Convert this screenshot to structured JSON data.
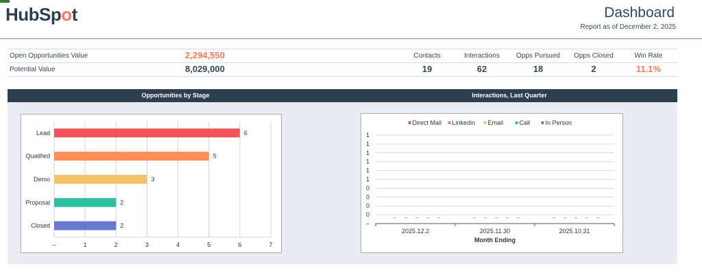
{
  "header": {
    "logo_text_a": "HubSp",
    "logo_text_b": "t",
    "title": "Dashboard",
    "report_date": "Report as of December 2, 2025"
  },
  "kpis": {
    "open_label": "Open Opportunities Value",
    "open_value": "2,294,550",
    "potential_label": "Potential Value",
    "potential_value": "8,029,000",
    "metrics": [
      {
        "label": "Contacts",
        "value": "19"
      },
      {
        "label": "Interactions",
        "value": "62"
      },
      {
        "label": "Opps Pursued",
        "value": "18"
      },
      {
        "label": "Opps Closed",
        "value": "2"
      },
      {
        "label": "Win Rate",
        "value": "11.1%"
      }
    ]
  },
  "panels": {
    "left_title": "Opportunities by Stage",
    "right_title": "Interactions, Last Quarter"
  },
  "chart_data": [
    {
      "type": "bar",
      "orientation": "horizontal",
      "title": "Opportunities by Stage",
      "categories": [
        "Lead",
        "Qualified",
        "Demo",
        "Proposal",
        "Closed"
      ],
      "values": [
        6,
        5,
        3,
        2,
        2
      ],
      "colors": [
        "#f2545b",
        "#ff8f59",
        "#f5c26b",
        "#2fbfa0",
        "#6a78d1"
      ],
      "x_ticks": [
        "–",
        "1",
        "2",
        "3",
        "4",
        "5",
        "6",
        "7"
      ],
      "xlim": [
        0,
        7
      ],
      "grid": true,
      "legend": "none"
    },
    {
      "type": "line",
      "title": "Interactions, Last Quarter",
      "xlabel": "Month Ending",
      "categories": [
        "2025.12.2",
        "2025.11.30",
        "2025.10.31"
      ],
      "y_ticks": [
        "1",
        "1",
        "1",
        "1",
        "1",
        "1",
        "0",
        "0",
        "0",
        "0",
        "–"
      ],
      "series": [
        {
          "name": "Direct Mail",
          "color": "#f2545b",
          "values": [
            0,
            0,
            0
          ]
        },
        {
          "name": "Linkedin",
          "color": "#ff7a59",
          "values": [
            0,
            0,
            0
          ]
        },
        {
          "name": "Email",
          "color": "#f5c26b",
          "values": [
            0,
            0,
            0
          ]
        },
        {
          "name": "Call",
          "color": "#2fbfa0",
          "values": [
            0,
            0,
            0
          ]
        },
        {
          "name": "In Person",
          "color": "#6a78d1",
          "values": [
            0,
            0,
            0
          ]
        }
      ],
      "zero_dash_marker": "–",
      "grid": true,
      "legend": "top-center"
    }
  ]
}
